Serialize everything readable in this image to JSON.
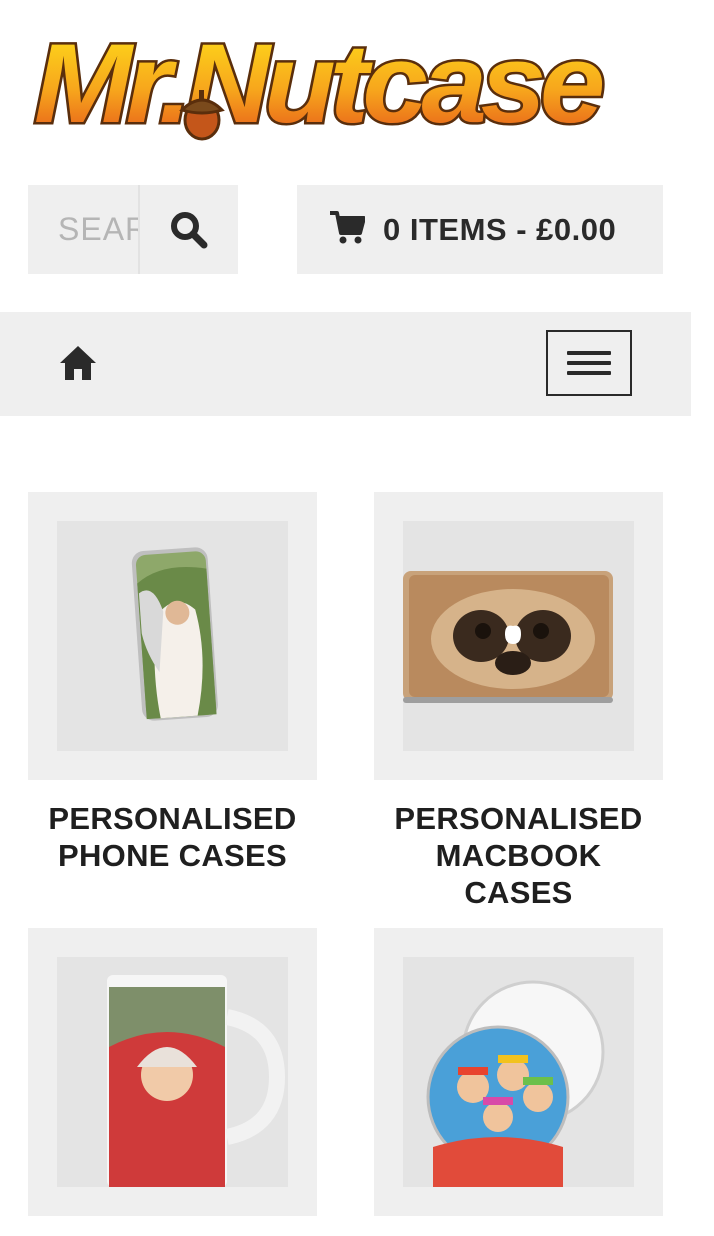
{
  "brand": {
    "logo_text": "Mr.Nutcase"
  },
  "search": {
    "placeholder": "SEARCH",
    "icon": "search-icon"
  },
  "cart": {
    "icon": "cart-icon",
    "label": "0 ITEMS - £0.00"
  },
  "nav": {
    "home_icon": "home-icon",
    "menu_icon": "hamburger-menu-icon"
  },
  "categories": [
    {
      "title": "PERSONALISED PHONE CASES"
    },
    {
      "title": "PERSONALISED MACBOOK CASES"
    },
    {
      "title": ""
    },
    {
      "title": ""
    }
  ],
  "colors": {
    "panel": "#efefef",
    "text": "#1f1f1f",
    "logo_orange": "#f5a21a",
    "logo_outline": "#5a2e0c"
  }
}
